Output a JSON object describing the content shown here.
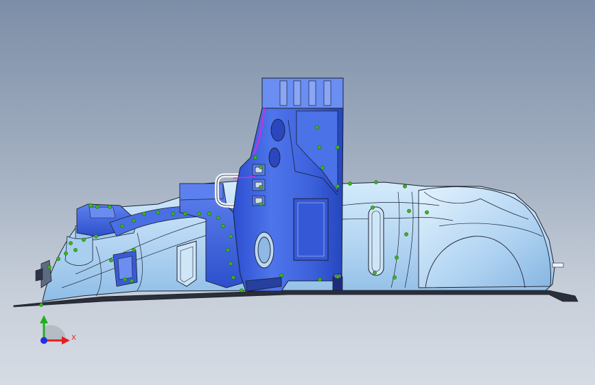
{
  "viewport": {
    "background_top": "#7c8ea7",
    "background_bottom": "#d6dce4"
  },
  "model": {
    "shell_color": "#b9d9f4",
    "shell_dark": "#7fb0dd",
    "fixture_color": "#3f62d6",
    "fixture_light": "#6b8ef0",
    "fixture_dark": "#1f3aa5",
    "edge_color": "#1a1f2e",
    "pin_color": "#39b31a",
    "highlight_color": "#d82bd8"
  },
  "triad": {
    "x_label": "X",
    "x_color": "#e02020",
    "y_color": "#1fb01f",
    "z_color": "#2030e0",
    "icon": "coordinate-triad-icon"
  }
}
